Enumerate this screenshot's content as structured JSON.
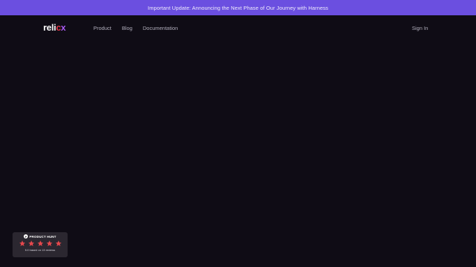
{
  "announcement": {
    "text": "Important Update: Announcing the Next Phase of Our Journey with Harness"
  },
  "nav": {
    "logo": {
      "part1": "reli",
      "part2": "c",
      "part3": "x"
    },
    "links": [
      {
        "label": "Product"
      },
      {
        "label": "Blog"
      },
      {
        "label": "Documentation"
      }
    ],
    "sign_in": "Sign In"
  },
  "product_hunt_badge": {
    "icon": "product-hunt-icon",
    "title": "PRODUCT HUNT",
    "icon_glyph": "P",
    "rating": 5,
    "max_rating": 5,
    "score_text": "5.0 based on 13 reviews",
    "star_color": "#e5484d"
  },
  "colors": {
    "background": "#0f0c15",
    "announcement_bg": "#6b4fe0",
    "logo_accent_red": "#e63a4a",
    "logo_accent_purple": "#a85bf0"
  }
}
